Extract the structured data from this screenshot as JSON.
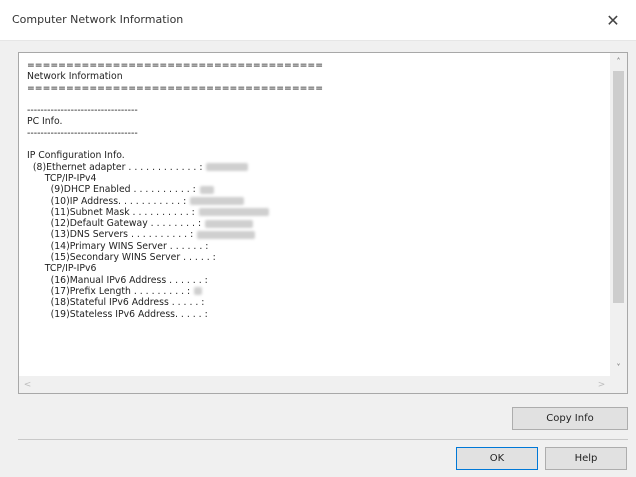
{
  "window": {
    "title": "Computer Network Information",
    "close_glyph": "✕"
  },
  "info": {
    "lines": [
      {
        "text": "======================================"
      },
      {
        "text": "Network Information"
      },
      {
        "text": "======================================"
      },
      {
        "text": ""
      },
      {
        "text": "---------------------------------"
      },
      {
        "text": "PC Info."
      },
      {
        "text": "---------------------------------"
      },
      {
        "text": ""
      },
      {
        "text": "IP Configuration Info."
      },
      {
        "text": "  (8)Ethernet adapter . . . . . . . . . . . . :",
        "redacted": true
      },
      {
        "text": "      TCP/IP-IPv4"
      },
      {
        "text": "        (9)DHCP Enabled . . . . . . . . . . :",
        "redacted": true
      },
      {
        "text": "        (10)IP Address. . . . . . . . . . . :",
        "redacted": true
      },
      {
        "text": "        (11)Subnet Mask . . . . . . . . . . :",
        "redacted": true
      },
      {
        "text": "        (12)Default Gateway . . . . . . . . :",
        "redacted": true
      },
      {
        "text": "        (13)DNS Servers . . . . . . . . . . :",
        "redacted": true
      },
      {
        "text": "        (14)Primary WINS Server . . . . . . :"
      },
      {
        "text": "        (15)Secondary WINS Server . . . . . :"
      },
      {
        "text": "      TCP/IP-IPv6"
      },
      {
        "text": "        (16)Manual IPv6 Address . . . . . . :"
      },
      {
        "text": "        (17)Prefix Length . . . . . . . . . :",
        "redacted": true
      },
      {
        "text": "        (18)Stateful IPv6 Address . . . . . :"
      },
      {
        "text": "        (19)Stateless IPv6 Address. . . . . :"
      }
    ]
  },
  "scroll": {
    "up_glyph": "˄",
    "down_glyph": "˅",
    "left_glyph": "<",
    "right_glyph": ">"
  },
  "buttons": {
    "copy_info": "Copy Info",
    "ok": "OK",
    "help": "Help"
  }
}
